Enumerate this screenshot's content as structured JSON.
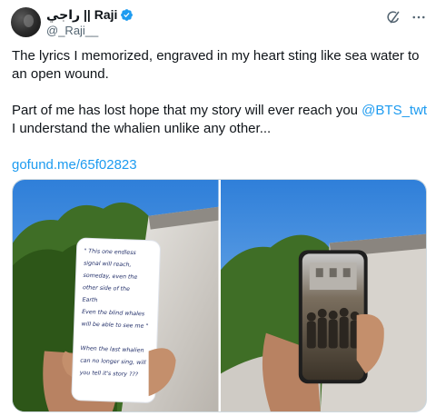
{
  "author": {
    "display_name": "راجي || Raji",
    "handle": "@_Raji__",
    "verified": true,
    "avatar_icon": "avatar-photo"
  },
  "actions": {
    "grok_icon": "grok-icon",
    "more_icon": "more-icon"
  },
  "tweet": {
    "paragraph1": "The lyrics I memorized, engraved in my heart sting like sea water to an open wound.",
    "paragraph2_prefix": "Part of me has lost hope that my story will ever reach you ",
    "paragraph2_mention": "@BTS_twt",
    "paragraph2_suffix": " I understand the whalien unlike any other...",
    "link": "gofund.me/65f02823"
  },
  "media": {
    "note_lines": [
      "\" This one endless",
      "signal will reach,",
      "someday, even the",
      "other side of the",
      "Earth",
      "Even the blind whales",
      "will be able to see me \"",
      "",
      "When the last whalien",
      "can no longer sing, will",
      "you tell it's story ???"
    ]
  },
  "colors": {
    "accent": "#1d9bf0",
    "text": "#0f1419",
    "muted": "#536471"
  }
}
